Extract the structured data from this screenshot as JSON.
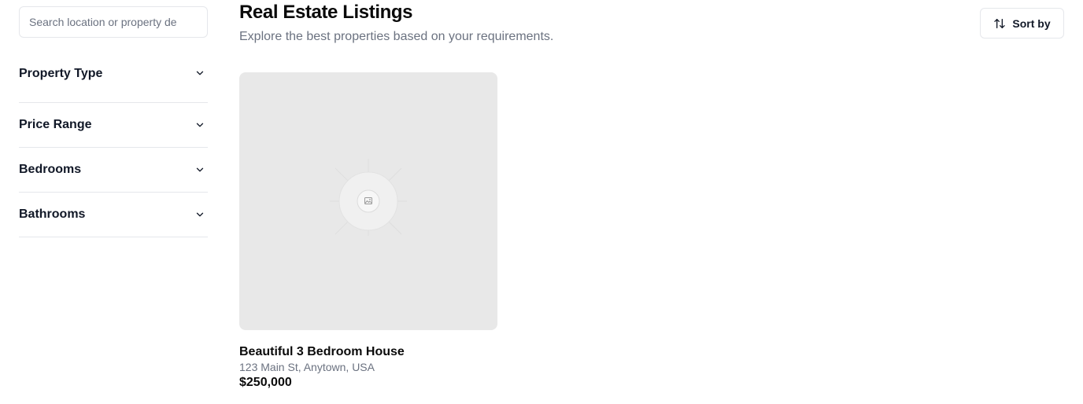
{
  "sidebar": {
    "search": {
      "placeholder": "Search location or property de",
      "value": ""
    },
    "filters": [
      {
        "label": "Property Type",
        "icon": "chevron-down-icon"
      },
      {
        "label": "Price Range",
        "icon": "chevron-down-icon"
      },
      {
        "label": "Bedrooms",
        "icon": "chevron-down-icon"
      },
      {
        "label": "Bathrooms",
        "icon": "chevron-down-icon"
      }
    ]
  },
  "header": {
    "title": "Real Estate Listings",
    "subtitle": "Explore the best properties based on your requirements."
  },
  "toolbar": {
    "sort_label": "Sort by",
    "sort_icon": "sort-arrows-icon"
  },
  "listings": [
    {
      "image_icon": "image-placeholder-icon",
      "title": "Beautiful 3 Bedroom House",
      "address": "123 Main St, Anytown, USA",
      "price": "$250,000"
    }
  ],
  "colors": {
    "text_primary": "#111827",
    "text_muted": "#6b7280",
    "border": "#e5e7eb",
    "image_placeholder_bg": "#e8e8e8"
  }
}
